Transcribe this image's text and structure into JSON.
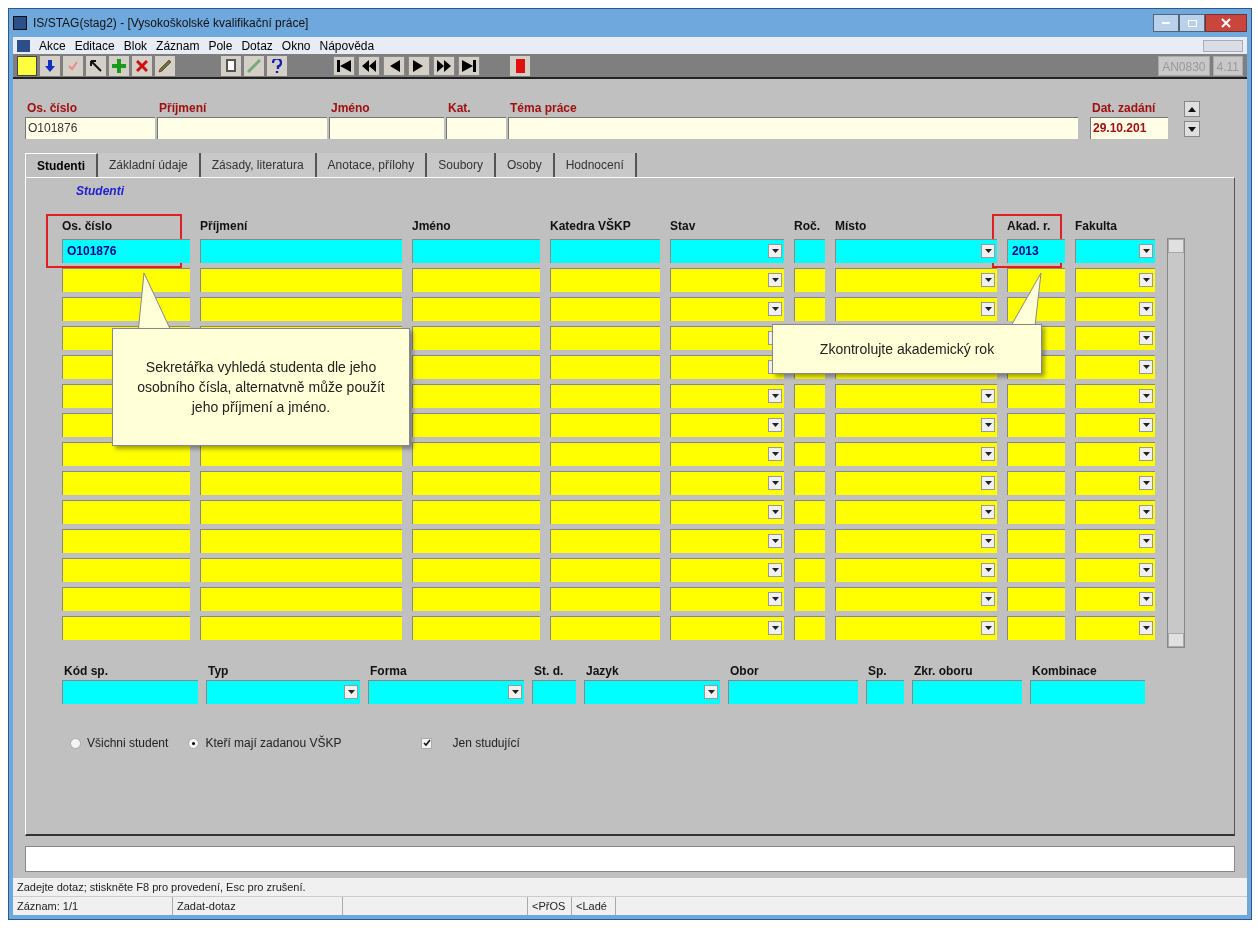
{
  "window": {
    "title": "IS/STAG(stag2) - [Vysokoškolské kvalifikační práce]"
  },
  "menu": [
    "Akce",
    "Editace",
    "Blok",
    "Záznam",
    "Pole",
    "Dotaz",
    "Okno",
    "Nápověda"
  ],
  "toolbar_badges": [
    "AN0830",
    "4.11"
  ],
  "header_fields": [
    {
      "label": "Os. číslo",
      "value": "O101876"
    },
    {
      "label": "Příjmení"
    },
    {
      "label": "Jméno"
    },
    {
      "label": "Kat."
    },
    {
      "label": "Téma práce"
    },
    {
      "label": "Dat. zadání",
      "value": "29.10.201"
    }
  ],
  "tabs": [
    {
      "label": "Studenti",
      "selected": true
    },
    {
      "label": "Základní údaje",
      "selected": false
    },
    {
      "label": "Zásady, literatura",
      "selected": false
    },
    {
      "label": "Anotace, přílohy",
      "selected": false
    },
    {
      "label": "Soubory",
      "selected": false
    },
    {
      "label": "Osoby",
      "selected": false
    },
    {
      "label": "Hodnocení",
      "selected": false
    }
  ],
  "section_title": "Studenti",
  "table": {
    "columns": [
      {
        "label": "Os. číslo",
        "kind": "text"
      },
      {
        "label": "Příjmení",
        "kind": "text"
      },
      {
        "label": "Jméno",
        "kind": "text"
      },
      {
        "label": "Katedra VŠKP",
        "kind": "text"
      },
      {
        "label": "Stav",
        "kind": "dropdown"
      },
      {
        "label": "Roč.",
        "kind": "text"
      },
      {
        "label": "Místo",
        "kind": "dropdown"
      },
      {
        "label": "Akad. r.",
        "kind": "text"
      },
      {
        "label": "Fakulta",
        "kind": "dropdown"
      }
    ],
    "rows": [
      {
        "selected": true,
        "cells": {
          "0": "O101876",
          "7": "2013"
        }
      },
      {
        "selected": false
      },
      {
        "selected": false
      },
      {
        "selected": false
      },
      {
        "selected": false
      },
      {
        "selected": false
      },
      {
        "selected": false
      },
      {
        "selected": false
      },
      {
        "selected": false
      },
      {
        "selected": false
      },
      {
        "selected": false
      },
      {
        "selected": false
      },
      {
        "selected": false
      },
      {
        "selected": false
      }
    ]
  },
  "callouts": [
    {
      "text": "Sekretářka vyhledá studenta dle jeho osobního čísla, alternatvně může použít jeho příjmení a jméno."
    },
    {
      "text": "Zkontrolujte akademický rok"
    }
  ],
  "detail_fields": [
    {
      "label": "Kód sp.",
      "kind": "text"
    },
    {
      "label": "Typ",
      "kind": "dropdown"
    },
    {
      "label": "Forma",
      "kind": "dropdown"
    },
    {
      "label": "St. d.",
      "kind": "text"
    },
    {
      "label": "Jazyk",
      "kind": "dropdown"
    },
    {
      "label": "Obor",
      "kind": "text"
    },
    {
      "label": "Sp.",
      "kind": "text"
    },
    {
      "label": "Zkr. oboru",
      "kind": "text"
    },
    {
      "label": "Kombinace",
      "kind": "text"
    }
  ],
  "radios": [
    {
      "label": "Všichni student",
      "selected": false
    },
    {
      "label": "Kteří mají zadanou VŠKP",
      "selected": true
    }
  ],
  "checkbox": {
    "label": "Jen studující",
    "checked": true
  },
  "message": "Zadejte dotaz; stiskněte F8 pro provedení, Esc  pro zrušení.",
  "status_bar": [
    "Záznam: 1/1",
    "Zadat-dotaz",
    "<PřOS",
    "<Ladé"
  ]
}
